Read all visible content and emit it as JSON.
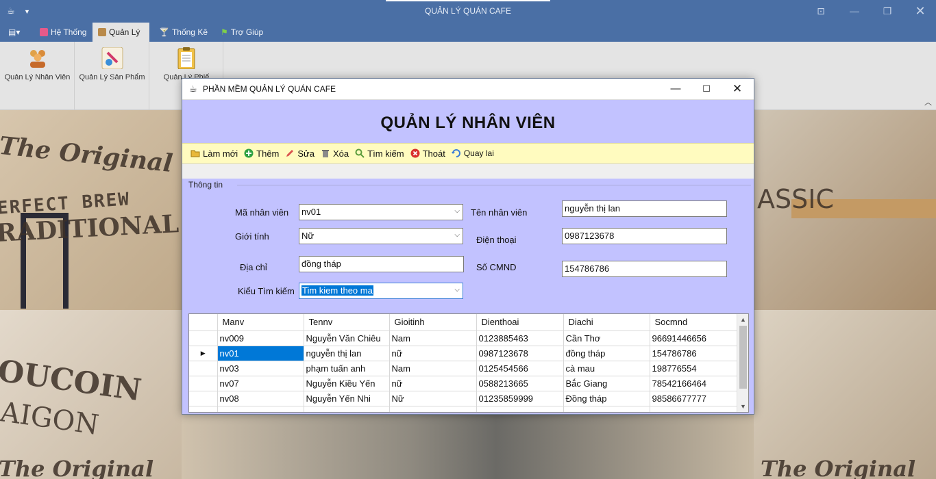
{
  "window": {
    "title": "QUẢN LÝ QUÁN CAFE"
  },
  "quick_access": {
    "app_icon": "coffee-cup-icon",
    "dropdown_icon": "chevron-down-icon"
  },
  "ribbon_tabs": [
    {
      "label": "Hệ Thống",
      "icon": "calendar-icon"
    },
    {
      "label": "Quản Lý",
      "icon": "briefcase-icon"
    },
    {
      "label": "Thống Kê",
      "icon": "cocktail-icon"
    },
    {
      "label": "Trợ Giúp",
      "icon": "flag-icon"
    }
  ],
  "ribbon_buttons": [
    {
      "label": "Quản Lý Nhân Viên",
      "icon": "people-icon"
    },
    {
      "label": "Quản Lý Sản Phẩm",
      "icon": "product-icon"
    },
    {
      "label": "Quản Lý Phiế",
      "icon": "clipboard-icon"
    }
  ],
  "background_text": {
    "a": "The Original",
    "b": "ERFECT BREW",
    "c": "RADITIONAL",
    "d": "OUCOIN",
    "e": "AIGON",
    "f": "ASSIC",
    "g": "The Original",
    "h": "The Original"
  },
  "dialog": {
    "title": "PHẦN MỀM QUẢN LÝ QUÁN CAFE",
    "heading": "QUẢN LÝ NHÂN VIÊN",
    "toolbar": [
      {
        "label": "Làm mới",
        "icon": "folder-icon",
        "color": "#e8b83a"
      },
      {
        "label": "Thêm",
        "icon": "add-icon",
        "color": "#2ea043"
      },
      {
        "label": "Sửa",
        "icon": "pencil-icon",
        "color": "#d9534f"
      },
      {
        "label": "Xóa",
        "icon": "trash-icon",
        "color": "#8a8a8a"
      },
      {
        "label": "Tìm kiếm",
        "icon": "search-icon",
        "color": "#5a9b3c"
      },
      {
        "label": "Thoát",
        "icon": "exit-icon",
        "color": "#d9302c"
      },
      {
        "label": "Quay lai",
        "icon": "back-icon",
        "color": "#3b7dd8"
      }
    ],
    "group_label": "Thông tin",
    "form": {
      "ma_nv_label": "Mã nhân viên",
      "ma_nv_value": "nv01",
      "ten_nv_label": "Tên nhân viên",
      "ten_nv_value": "nguyễn thị lan",
      "gioi_tinh_label": "Giới tính",
      "gioi_tinh_value": "Nữ",
      "dien_thoai_label": "Điện thoại",
      "dien_thoai_value": "0987123678",
      "dia_chi_label": "Địa chỉ",
      "dia_chi_value": "đồng tháp",
      "cmnd_label": "Số CMND",
      "cmnd_value": "154786786",
      "kieu_tk_label": "Kiểu Tìm kiếm",
      "kieu_tk_value": "Tim kiem theo ma"
    },
    "grid": {
      "columns": [
        "Manv",
        "Tennv",
        "Gioitinh",
        "Dienthoai",
        "Diachi",
        "Socmnd"
      ],
      "selected_row": 1,
      "rows": [
        [
          "nv009",
          "Nguyễn Văn Chiêu",
          "Nam",
          "0123885463",
          "Cần Thơ",
          "96691446656"
        ],
        [
          "nv01",
          "nguyễn thị lan",
          "nữ",
          "0987123678",
          "đồng tháp",
          "154786786"
        ],
        [
          "nv03",
          "phạm tuấn anh",
          "Nam",
          "0125454566",
          "cà mau",
          "198776554"
        ],
        [
          "nv07",
          "Nguyễn Kiều Yến",
          "nữ",
          "0588213665",
          "Bắc Giang",
          "78542166464"
        ],
        [
          "nv08",
          "Nguyễn Yến Nhi",
          "Nữ",
          "01235859999",
          "Đồng tháp",
          "98586677777"
        ]
      ]
    }
  },
  "colors": {
    "titlebar": "#4a6fa5",
    "dialog_bg": "#c2c2ff",
    "toolbar_bg": "#fffbbf",
    "selection": "#0078d7"
  }
}
